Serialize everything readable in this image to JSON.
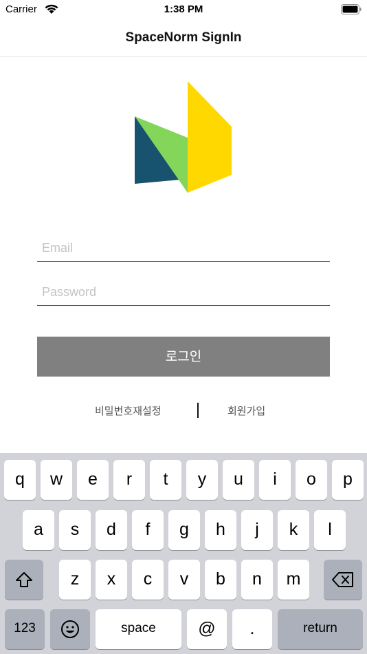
{
  "status_bar": {
    "carrier": "Carrier",
    "time": "1:38 PM",
    "wifi_icon": "wifi-icon",
    "battery_icon": "battery-icon"
  },
  "nav": {
    "title": "SpaceNorm SignIn"
  },
  "logo": {
    "icon": "spacenorm-logo-icon",
    "colors": {
      "navy": "#17526e",
      "green": "#84d65b",
      "yellow": "#ffd800"
    }
  },
  "form": {
    "email_placeholder": "Email",
    "email_value": "",
    "password_placeholder": "Password",
    "password_value": "",
    "login_label": "로그인",
    "login_color": "#808080"
  },
  "links": {
    "reset_password": "비밀번호재설정",
    "signup": "회원가입"
  },
  "keyboard": {
    "row1": [
      "q",
      "w",
      "e",
      "r",
      "t",
      "y",
      "u",
      "i",
      "o",
      "p"
    ],
    "row2": [
      "a",
      "s",
      "d",
      "f",
      "g",
      "h",
      "j",
      "k",
      "l"
    ],
    "row3": [
      "z",
      "x",
      "c",
      "v",
      "b",
      "n",
      "m"
    ],
    "numbers_label": "123",
    "space_label": "space",
    "at_label": "@",
    "dot_label": ".",
    "return_label": "return",
    "shift_icon": "shift-icon",
    "delete_icon": "delete-icon",
    "emoji_icon": "emoji-icon"
  }
}
